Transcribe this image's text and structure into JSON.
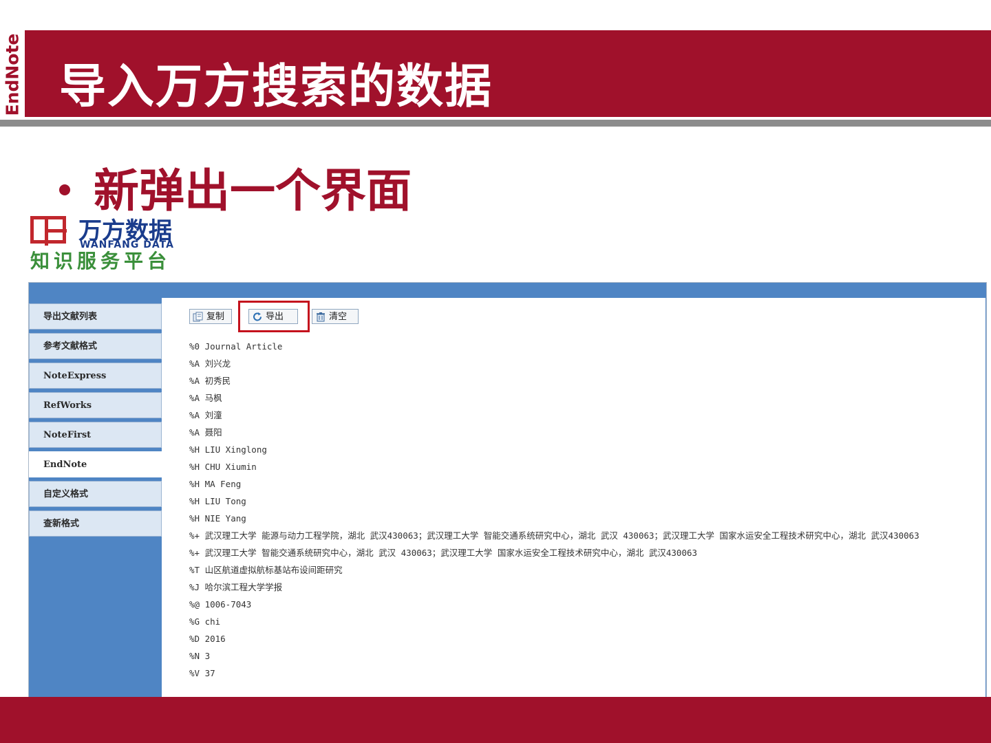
{
  "brand": {
    "vertical_logo": "EndNote"
  },
  "slide": {
    "title": "导入万方搜索的数据",
    "bullet": "新弹出一个界面"
  },
  "wanfang_logo": {
    "name_cn": "万方数据",
    "name_en": "WANFANG DATA",
    "subtitle": "知识服务平台"
  },
  "sidebar": {
    "items": [
      {
        "label": "导出文献列表"
      },
      {
        "label": "参考文献格式"
      },
      {
        "label": "NoteExpress"
      },
      {
        "label": "RefWorks"
      },
      {
        "label": "NoteFirst"
      },
      {
        "label": "EndNote",
        "active": true
      },
      {
        "label": "自定义格式"
      },
      {
        "label": "查新格式"
      }
    ]
  },
  "toolbar": {
    "copy_label": "复制",
    "export_label": "导出",
    "clear_label": "清空"
  },
  "records": [
    "%0 Journal Article",
    "%A 刘兴龙",
    "%A 初秀民",
    "%A 马枫",
    "%A 刘潼",
    "%A 聂阳",
    "%H LIU Xinglong",
    "%H CHU Xiumin",
    "%H MA Feng",
    "%H LIU Tong",
    "%H NIE Yang",
    "%+ 武汉理工大学 能源与动力工程学院，湖北 武汉430063；武汉理工大学 智能交通系统研究中心，湖北 武汉 430063；武汉理工大学 国家水运安全工程技术研究中心，湖北 武汉430063",
    "%+ 武汉理工大学 智能交通系统研究中心，湖北 武汉 430063；武汉理工大学 国家水运安全工程技术研究中心，湖北 武汉430063",
    "%T 山区航道虚拟航标基站布设间距研究",
    "%J 哈尔滨工程大学学报",
    "%@ 1006-7043",
    "%G chi",
    "%D 2016",
    "%N 3",
    "%V 37"
  ],
  "colors": {
    "brand_red": "#a0112b",
    "frame_blue": "#4f85c4",
    "highlight_red": "#c4121d"
  }
}
